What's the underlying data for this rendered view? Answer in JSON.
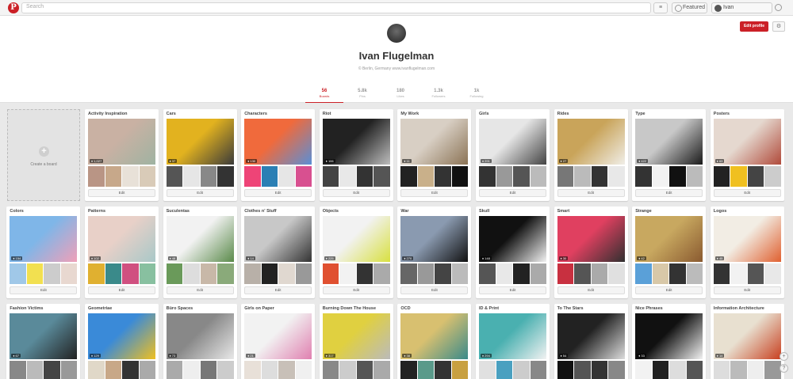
{
  "topbar": {
    "logo": "P",
    "search_placeholder": "Search",
    "menu_icon": "≡",
    "featured_label": "Featured",
    "user_label": "Ivan"
  },
  "profile": {
    "name": "Ivan Flugelman",
    "location_line": "© Berlin, Germany   www.ivanflugelman.com",
    "edit_label": "Edit profile",
    "gear_icon": "⚙"
  },
  "stats": [
    {
      "value": "56",
      "label": "Boards",
      "active": true
    },
    {
      "value": "5.8k",
      "label": "Pins",
      "active": false
    },
    {
      "value": "180",
      "label": "Likes",
      "active": false
    },
    {
      "value": "1.3k",
      "label": "Followers",
      "active": false
    },
    {
      "value": "1k",
      "label": "Following",
      "active": false
    }
  ],
  "create_board": {
    "icon": "+",
    "label": "Create a board"
  },
  "edit_label": "Edit",
  "colors": {
    "accent": "#cb2027"
  },
  "boards": [
    {
      "title": "Activity Inspiration",
      "count": "1,027",
      "main": [
        "#c9b1a3",
        "#9fb3a2"
      ],
      "thumbs": [
        "#b99585",
        "#c7a88a",
        "#e8e1d8",
        "#d9cbb8"
      ]
    },
    {
      "title": "Cars",
      "count": "37",
      "main": [
        "#e2b21f",
        "#3a3a3a"
      ],
      "thumbs": [
        "#555",
        "#e6e6e6",
        "#888",
        "#333"
      ]
    },
    {
      "title": "Characters",
      "count": "130",
      "main": [
        "#f06a3c",
        "#5a8fd6"
      ],
      "thumbs": [
        "#ee4477",
        "#2b7fb4",
        "#e6e6e6",
        "#d85090"
      ]
    },
    {
      "title": "Riot",
      "count": "106",
      "main": [
        "#222",
        "#bdbdbd"
      ],
      "thumbs": [
        "#444",
        "#e8e8e8",
        "#333",
        "#555"
      ]
    },
    {
      "title": "My Work",
      "count": "11",
      "main": [
        "#d8cfc4",
        "#8b7355"
      ],
      "thumbs": [
        "#222",
        "#c9b08a",
        "#333",
        "#111"
      ]
    },
    {
      "title": "Girls",
      "count": "291",
      "main": [
        "#e6e6e6",
        "#444"
      ],
      "thumbs": [
        "#333",
        "#999",
        "#555",
        "#bbb"
      ]
    },
    {
      "title": "Rides",
      "count": "27",
      "main": [
        "#c9a45a",
        "#f0eee8"
      ],
      "thumbs": [
        "#777",
        "#bbb",
        "#333",
        "#e8e8e8"
      ]
    },
    {
      "title": "Type",
      "count": "422",
      "main": [
        "#c8c8c8",
        "#1a1a1a"
      ],
      "thumbs": [
        "#333",
        "#f2f2f2",
        "#111",
        "#bbb"
      ]
    },
    {
      "title": "Posters",
      "count": "63",
      "main": [
        "#e5d8cf",
        "#b04a3a"
      ],
      "thumbs": [
        "#222",
        "#f0c020",
        "#444",
        "#ccc"
      ]
    },
    {
      "title": "Colors",
      "count": "154",
      "main": [
        "#7fb6e8",
        "#f0a0b8"
      ],
      "thumbs": [
        "#a0c8e8",
        "#f2e050",
        "#ccc",
        "#e8d8d0"
      ]
    },
    {
      "title": "Patterns",
      "count": "102",
      "main": [
        "#e8d0c8",
        "#a8c8c8"
      ],
      "thumbs": [
        "#e0b030",
        "#3a8a8a",
        "#d05080",
        "#88c0a0"
      ]
    },
    {
      "title": "Suculentas",
      "count": "48",
      "main": [
        "#f2f2f2",
        "#5a8a4a"
      ],
      "thumbs": [
        "#6a9a5a",
        "#ddd",
        "#c8b8a8",
        "#8aaa7a"
      ]
    },
    {
      "title": "Clothes n' Stuff",
      "count": "14",
      "main": [
        "#c8c8c8",
        "#333"
      ],
      "thumbs": [
        "#b8b0a8",
        "#222",
        "#e0d8d0",
        "#999"
      ]
    },
    {
      "title": "Objects",
      "count": "225",
      "main": [
        "#f2f2f2",
        "#d8e040"
      ],
      "thumbs": [
        "#e05030",
        "#f2f2f2",
        "#333",
        "#aaa"
      ]
    },
    {
      "title": "War",
      "count": "270",
      "main": [
        "#8a9ab0",
        "#111"
      ],
      "thumbs": [
        "#666",
        "#999",
        "#444",
        "#bbb"
      ]
    },
    {
      "title": "Skull",
      "count": "148",
      "main": [
        "#111",
        "#f2f2f2"
      ],
      "thumbs": [
        "#555",
        "#e8e8e8",
        "#222",
        "#aaa"
      ]
    },
    {
      "title": "Smart",
      "count": "30",
      "main": [
        "#e04060",
        "#303030"
      ],
      "thumbs": [
        "#c83040",
        "#555",
        "#aaa",
        "#e0e0e0"
      ]
    },
    {
      "title": "Strange",
      "count": "42",
      "main": [
        "#c8a860",
        "#8a5a30"
      ],
      "thumbs": [
        "#5aa0d8",
        "#d8c8a8",
        "#333",
        "#bbb"
      ]
    },
    {
      "title": "Logos",
      "count": "45",
      "main": [
        "#f2ede4",
        "#e06030"
      ],
      "thumbs": [
        "#333",
        "#f2f2f2",
        "#555",
        "#e8e8e8"
      ]
    },
    {
      "title": "Fashion Victims",
      "count": "67",
      "main": [
        "#5a8a9a",
        "#222"
      ],
      "thumbs": [
        "#888",
        "#bbb",
        "#444",
        "#999"
      ]
    },
    {
      "title": "Geometriae",
      "count": "129",
      "main": [
        "#3a8ad8",
        "#f0c020"
      ],
      "thumbs": [
        "#e0d8c8",
        "#c8a888",
        "#333",
        "#aaa"
      ]
    },
    {
      "title": "Büro Spaces",
      "count": "73",
      "main": [
        "#888",
        "#e8e8e8"
      ],
      "thumbs": [
        "#aaa",
        "#eee",
        "#777",
        "#ccc"
      ]
    },
    {
      "title": "Girls on Paper",
      "count": "21",
      "main": [
        "#f2f2f2",
        "#e080b0"
      ],
      "thumbs": [
        "#e8e0d8",
        "#ddd",
        "#c8c0b8",
        "#f0f0f0"
      ]
    },
    {
      "title": "Burning Down The House",
      "count": "317",
      "main": [
        "#e0d040",
        "#bbb"
      ],
      "thumbs": [
        "#888",
        "#ccc",
        "#555",
        "#aaa"
      ]
    },
    {
      "title": "OCD",
      "count": "38",
      "main": [
        "#d8c070",
        "#3a8a8a"
      ],
      "thumbs": [
        "#222",
        "#5a9a8a",
        "#333",
        "#c8a040"
      ]
    },
    {
      "title": "ID & Print",
      "count": "294",
      "main": [
        "#4ab0b0",
        "#f2f2f2"
      ],
      "thumbs": [
        "#e0e0e0",
        "#4aa0c0",
        "#ccc",
        "#888"
      ]
    },
    {
      "title": "To The Stars",
      "count": "54",
      "main": [
        "#222",
        "#ddd"
      ],
      "thumbs": [
        "#111",
        "#555",
        "#333",
        "#888"
      ]
    },
    {
      "title": "Nice Phrases",
      "count": "33",
      "main": [
        "#111",
        "#f2f2f2"
      ],
      "thumbs": [
        "#f2f2f2",
        "#222",
        "#ddd",
        "#555"
      ]
    },
    {
      "title": "Information Architecture",
      "count": "14",
      "main": [
        "#e8e0d0",
        "#c84020"
      ],
      "thumbs": [
        "#ddd",
        "#bbb",
        "#eee",
        "#999"
      ]
    }
  ]
}
